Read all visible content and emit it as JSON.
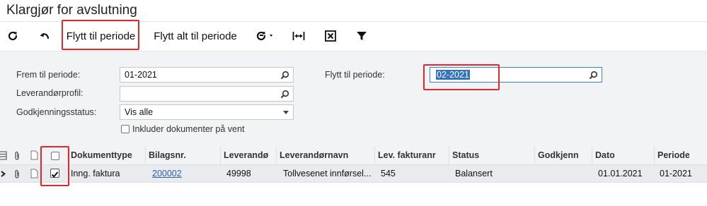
{
  "page": {
    "title": "Klargjør for avslutning"
  },
  "toolbar": {
    "refresh_icon": "refresh-icon",
    "undo_icon": "undo-icon",
    "move_to_period_label": "Flytt til periode",
    "move_all_to_period_label": "Flytt alt til periode",
    "highlight_color": "#e0282e"
  },
  "filters": {
    "from_period_label": "Frem til periode:",
    "from_period_value": "01-2021",
    "vendor_profile_label": "Leverandørprofil:",
    "vendor_profile_value": "",
    "approval_status_label": "Godkjenningsstatus:",
    "approval_status_value": "Vis alle",
    "include_on_hold_label": "Inkluder dokumenter på vent",
    "move_to_period_label": "Flytt til periode:",
    "move_to_period_value": "02-2021"
  },
  "grid": {
    "columns": [
      "Dokumenttype",
      "Bilagsnr.",
      "Leverandø",
      "Leverandørnavn",
      "Lev. fakturanr",
      "Status",
      "Godkjenn",
      "Dato",
      "Periode"
    ],
    "rows": [
      {
        "selected": true,
        "document_type": "Inng. faktura",
        "ref_nbr": "200002",
        "vendor": "49998",
        "vendor_name": "Tollvesenet innførsel...",
        "vendor_invoice": "545",
        "status": "Balansert",
        "approval": "",
        "date": "01.01.2021",
        "period": "01-2021"
      }
    ]
  }
}
